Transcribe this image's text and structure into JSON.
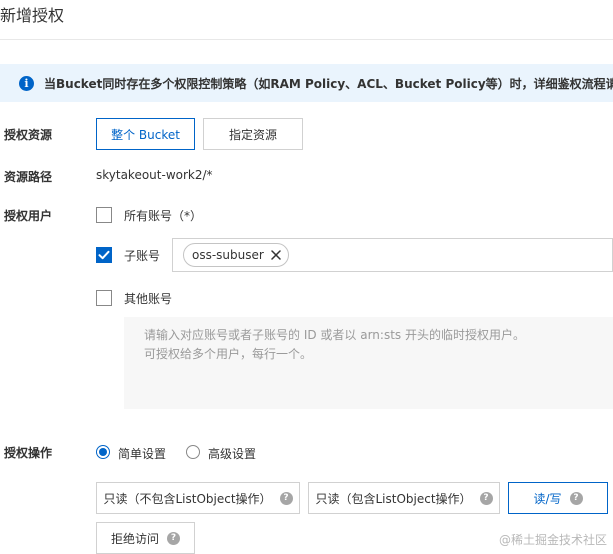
{
  "title": "新增授权",
  "info_bar": {
    "text": "当Bucket同时存在多个权限控制策略（如RAM Policy、ACL、Bucket Policy等）时，详细鉴权流程请参见OSS"
  },
  "resource": {
    "label": "授权资源",
    "options": [
      "整个 Bucket",
      "指定资源"
    ],
    "selected": "整个 Bucket"
  },
  "path": {
    "label": "资源路径",
    "value": "skytakeout-work2/*"
  },
  "users": {
    "label": "授权用户",
    "all_accounts": {
      "label": "所有账号（*）",
      "checked": false
    },
    "sub_account": {
      "label": "子账号",
      "checked": true,
      "tags": [
        "oss-subuser"
      ]
    },
    "other_accounts": {
      "label": "其他账号",
      "checked": false,
      "placeholder_line1": "请输入对应账号或者子账号的 ID 或者以 arn:sts 开头的临时授权用户。",
      "placeholder_line2": "可授权给多个用户，每行一个。"
    }
  },
  "operation": {
    "label": "授权操作",
    "modes": [
      "简单设置",
      "高级设置"
    ],
    "selected_mode": "简单设置",
    "buttons": {
      "readonly_excl": "只读（不包含ListObject操作）",
      "readonly_incl": "只读（包含ListObject操作）",
      "read_write": "读/写",
      "deny": "拒绝访问"
    },
    "selected_button": "读/写"
  },
  "watermark": "@稀土掘金技术社区",
  "colors": {
    "accent": "#0064c8",
    "info_bg": "#eaf4fd"
  }
}
